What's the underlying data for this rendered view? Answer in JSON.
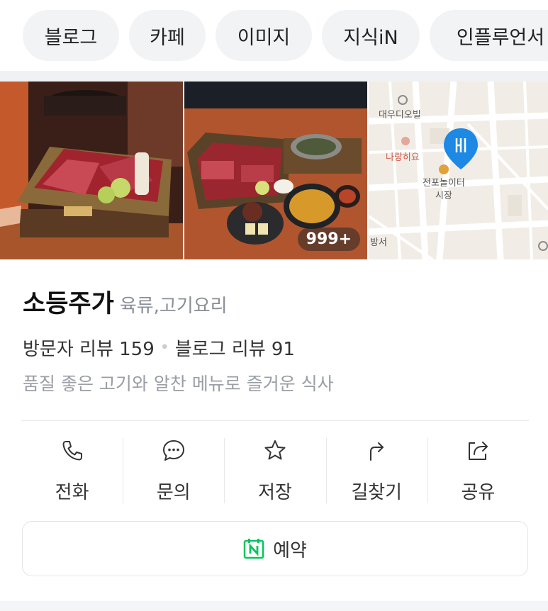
{
  "chips": [
    "블로그",
    "카페",
    "이미지",
    "지식iN",
    "인플루언서"
  ],
  "photos": {
    "count_badge": "999+"
  },
  "map": {
    "labels": [
      "대우디오빌",
      "나랑히요",
      "전포놀이터",
      "시장",
      "방서"
    ]
  },
  "place": {
    "name": "소등주가",
    "category": "육류,고기요리",
    "visitor_reviews": "방문자 리뷰 159",
    "blog_reviews": "블로그 리뷰 91",
    "description": "품질 좋은 고기와 알찬 메뉴로 즐거운 식사"
  },
  "actions": [
    {
      "label": "전화",
      "icon": "phone-icon"
    },
    {
      "label": "문의",
      "icon": "chat-bubble-icon"
    },
    {
      "label": "저장",
      "icon": "star-icon"
    },
    {
      "label": "길찾기",
      "icon": "directions-arrow-icon"
    },
    {
      "label": "공유",
      "icon": "share-icon"
    }
  ],
  "reserve": {
    "label": "예약",
    "icon": "naver-calendar-icon"
  },
  "colors": {
    "naver_green": "#03c75a",
    "map_pin": "#1e88e5",
    "map_poi": "#e0a23a"
  }
}
